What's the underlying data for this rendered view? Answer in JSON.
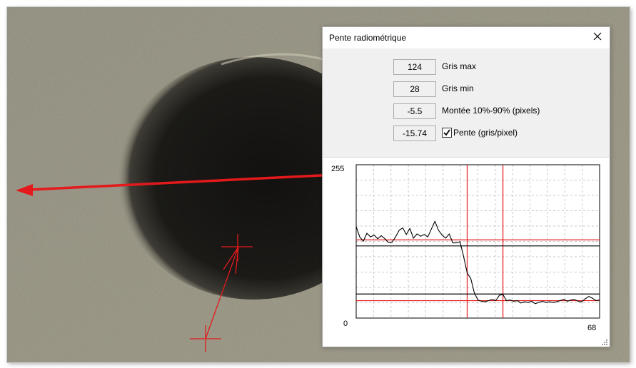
{
  "dialog": {
    "title": "Pente radiométrique",
    "fields": [
      {
        "value": "124",
        "label": "Gris max"
      },
      {
        "value": "28",
        "label": "Gris min"
      },
      {
        "value": "-5.5",
        "label": "Montée 10%-90% (pixels)"
      },
      {
        "value": "-15.74",
        "label": "Pente (gris/pixel)",
        "checked": true
      }
    ],
    "icons": {
      "close": "close-icon",
      "checkbox": "checkmark-icon",
      "grip": "resize-grip-icon"
    }
  },
  "chart_data": {
    "type": "line",
    "ylim": [
      0,
      255
    ],
    "xlim": [
      0,
      68
    ],
    "y_tick_labels": [
      "255"
    ],
    "x_tick_labels": [
      "0",
      "68"
    ],
    "grid": true,
    "series": [
      {
        "color": "#000000",
        "x": [
          0,
          1,
          2,
          3,
          4,
          5,
          6,
          7,
          8,
          9,
          10,
          11,
          12,
          13,
          14,
          15,
          16,
          17,
          18,
          19,
          20,
          21,
          22,
          23,
          24,
          25,
          26,
          27,
          28,
          29,
          30,
          31,
          32,
          33,
          34,
          35,
          36,
          37,
          38,
          39,
          40,
          41,
          42,
          43,
          44,
          45,
          46,
          47,
          48,
          49,
          50,
          51,
          52,
          53,
          54,
          55,
          56,
          57,
          58,
          59,
          60,
          61,
          62,
          63,
          64,
          65,
          66,
          67,
          68
        ],
        "y": [
          152,
          135,
          128,
          141,
          135,
          138,
          132,
          137,
          132,
          126,
          126,
          135,
          146,
          150,
          139,
          149,
          133,
          140,
          136,
          139,
          135,
          148,
          161,
          146,
          138,
          133,
          140,
          125,
          125,
          127,
          103,
          75,
          66,
          42,
          30,
          28,
          27,
          29,
          31,
          29,
          38,
          39,
          29,
          30,
          28,
          29,
          25,
          27,
          26,
          28,
          24,
          26,
          28,
          26,
          27,
          26,
          27,
          29,
          31,
          28,
          30,
          31,
          28,
          27,
          32,
          36,
          33,
          29,
          30
        ]
      }
    ],
    "thresholds_black_y": [
      120,
      40
    ],
    "thresholds_red_y": [
      130,
      29
    ],
    "vertical_markers_red_x": [
      31,
      41
    ]
  },
  "scene": {
    "colors": {
      "accent": "#e3191b",
      "background": "#8e8b7a",
      "spot": "#1b1a17"
    }
  }
}
